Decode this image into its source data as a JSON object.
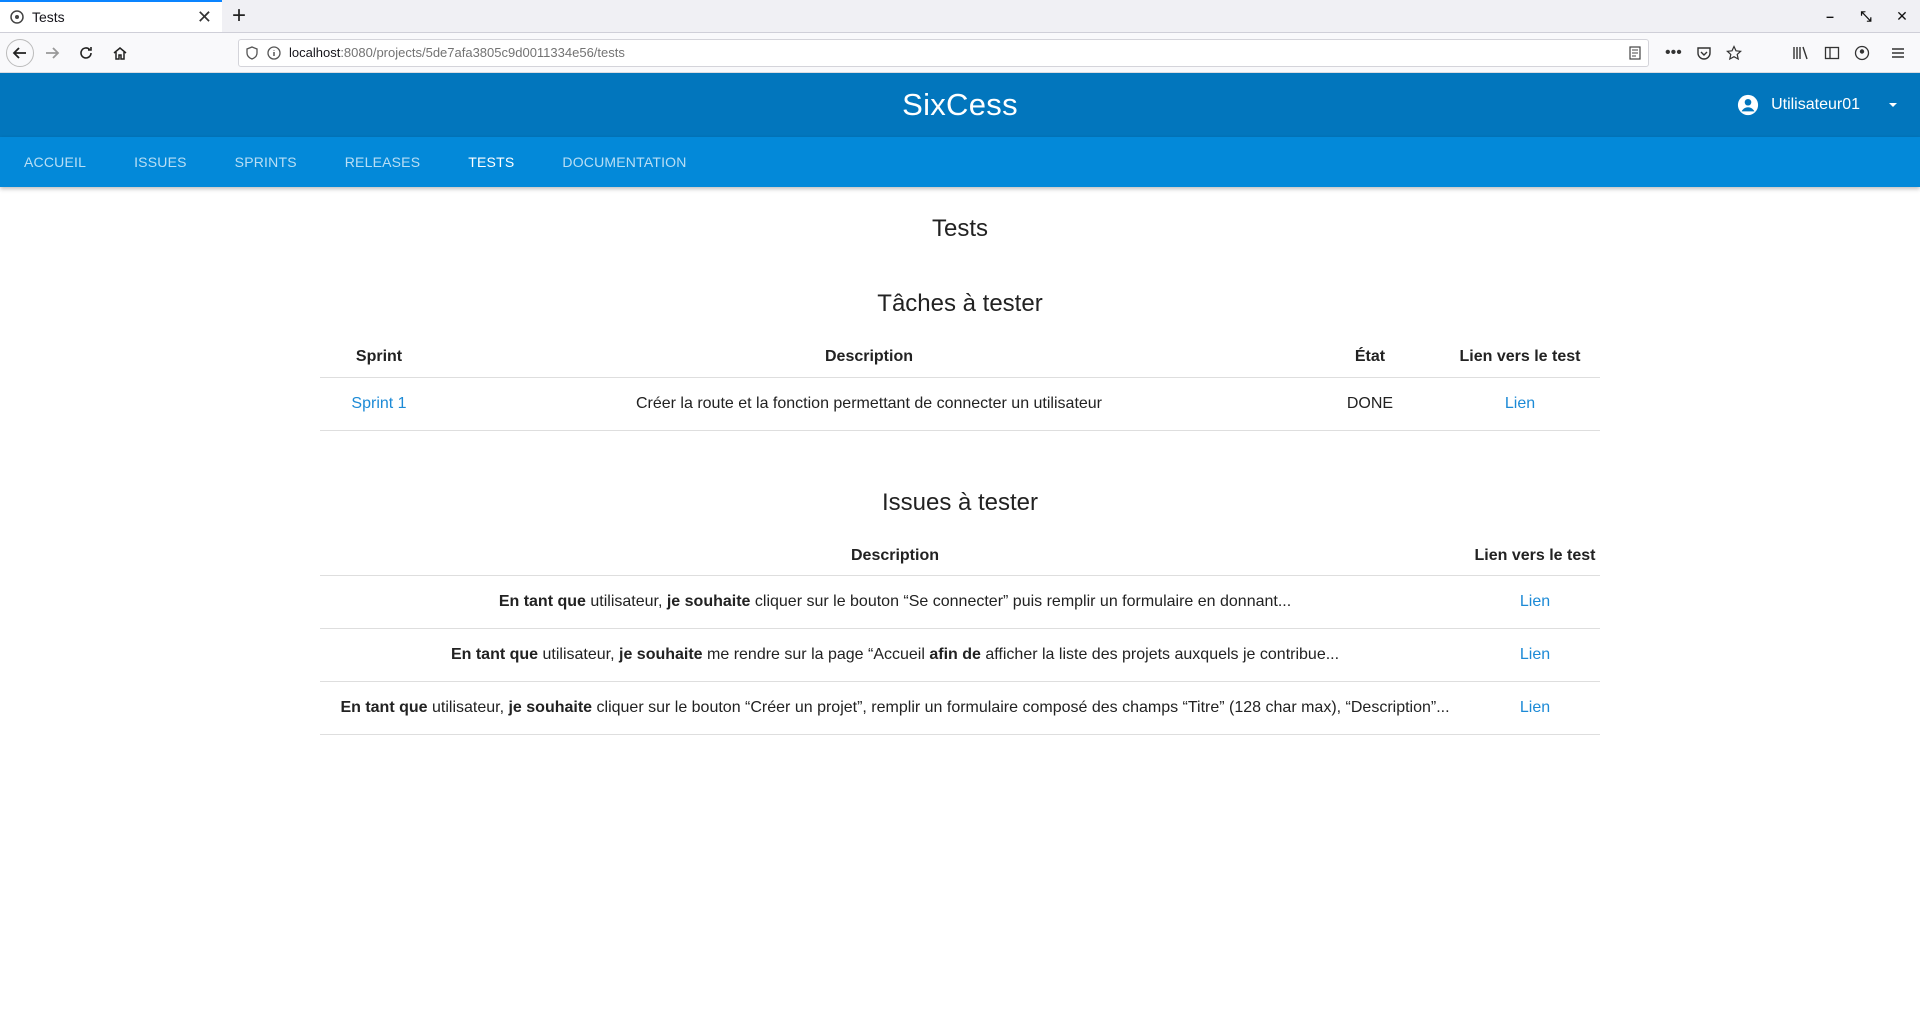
{
  "browser": {
    "tab_title": "Tests",
    "url_host": "localhost",
    "url_path": ":8080/projects/5de7afa3805c9d0011334e56/tests"
  },
  "app": {
    "title": "SixCess",
    "user": "Utilisateur01",
    "nav": [
      "ACCUEIL",
      "ISSUES",
      "SPRINTS",
      "RELEASES",
      "TESTS",
      "DOCUMENTATION"
    ],
    "active_nav": "TESTS"
  },
  "page": {
    "title": "Tests",
    "tasks": {
      "title": "Tâches à tester",
      "headers": [
        "Sprint",
        "Description",
        "État",
        "Lien vers le test"
      ],
      "rows": [
        {
          "sprint": "Sprint 1",
          "description": "Créer la route et la fonction permettant de connecter un utilisateur",
          "state": "DONE",
          "link": "Lien"
        }
      ]
    },
    "issues": {
      "title": "Issues à tester",
      "headers": [
        "Description",
        "Lien vers le test"
      ],
      "rows": [
        {
          "parts": [
            "En tant que",
            " utilisateur, ",
            "je souhaite",
            " cliquer sur le bouton “Se connecter” puis remplir un formulaire en donnant..."
          ],
          "link": "Lien"
        },
        {
          "parts": [
            "En tant que",
            " utilisateur, ",
            "je souhaite",
            " me rendre sur la page “Accueil ",
            "afin de",
            " afficher la liste des projets auxquels je contribue..."
          ],
          "link": "Lien"
        },
        {
          "parts": [
            "En tant que",
            " utilisateur, ",
            "je souhaite",
            " cliquer sur le bouton “Créer un projet”, remplir un formulaire composé des champs “Titre” (128 char max), “Description”..."
          ],
          "link": "Lien"
        }
      ]
    }
  }
}
